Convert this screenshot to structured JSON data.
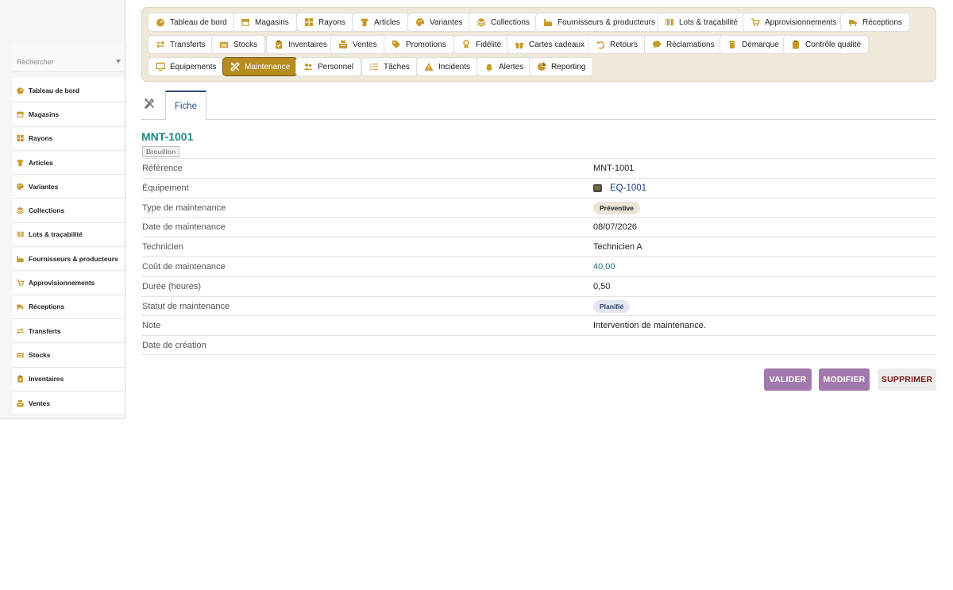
{
  "sidebar": {
    "search_placeholder": "Rechercher",
    "items": [
      {
        "label": "Tableau de bord",
        "icon": "dashboard-icon"
      },
      {
        "label": "Magasins",
        "icon": "store-icon"
      },
      {
        "label": "Rayons",
        "icon": "grid-icon"
      },
      {
        "label": "Articles",
        "icon": "shirt-icon"
      },
      {
        "label": "Variantes",
        "icon": "palette-icon"
      },
      {
        "label": "Collections",
        "icon": "layers-icon"
      },
      {
        "label": "Lots & traçabilité",
        "icon": "barcode-icon"
      },
      {
        "label": "Fournisseurs & producteurs",
        "icon": "factory-icon"
      },
      {
        "label": "Approvisionnements",
        "icon": "cart-icon"
      },
      {
        "label": "Réceptions",
        "icon": "truck-icon"
      },
      {
        "label": "Transferts",
        "icon": "transfer-icon"
      },
      {
        "label": "Stocks",
        "icon": "boxes-icon"
      },
      {
        "label": "Inventaires",
        "icon": "clipboard-icon"
      },
      {
        "label": "Ventes",
        "icon": "cash-register-icon"
      }
    ]
  },
  "topnav": {
    "items": [
      {
        "label": "Tableau de bord",
        "icon": "dashboard-icon"
      },
      {
        "label": "Magasins",
        "icon": "store-icon"
      },
      {
        "label": "Rayons",
        "icon": "grid-icon"
      },
      {
        "label": "Articles",
        "icon": "shirt-icon"
      },
      {
        "label": "Variantes",
        "icon": "palette-icon"
      },
      {
        "label": "Collections",
        "icon": "layers-icon"
      },
      {
        "label": "Fournisseurs & producteurs",
        "icon": "factory-icon"
      },
      {
        "label": "Lots & traçabilité",
        "icon": "barcode-icon"
      },
      {
        "label": "Approvisionnements",
        "icon": "cart-icon"
      },
      {
        "label": "Réceptions",
        "icon": "truck-icon"
      },
      {
        "label": "Transferts",
        "icon": "transfer-icon"
      },
      {
        "label": "Stocks",
        "icon": "boxes-icon"
      },
      {
        "label": "Inventaires",
        "icon": "clipboard-icon"
      },
      {
        "label": "Ventes",
        "icon": "cash-register-icon"
      },
      {
        "label": "Promotions",
        "icon": "tags-icon"
      },
      {
        "label": "Fidélité",
        "icon": "award-icon"
      },
      {
        "label": "Cartes cadeaux",
        "icon": "gift-icon"
      },
      {
        "label": "Retours",
        "icon": "undo-icon"
      },
      {
        "label": "Réclamations",
        "icon": "comment-icon"
      },
      {
        "label": "Démarque",
        "icon": "trash-icon"
      },
      {
        "label": "Contrôle qualité",
        "icon": "clipboard-check-icon"
      },
      {
        "label": "Équipements",
        "icon": "monitor-icon"
      },
      {
        "label": "Maintenance",
        "icon": "tools-icon"
      },
      {
        "label": "Personnel",
        "icon": "users-icon"
      },
      {
        "label": "Tâches",
        "icon": "tasks-icon"
      },
      {
        "label": "Incidents",
        "icon": "warning-icon"
      },
      {
        "label": "Alertes",
        "icon": "bell-icon"
      },
      {
        "label": "Reporting",
        "icon": "pie-chart-icon"
      }
    ],
    "active_label": "Maintenance"
  },
  "tabs": {
    "fiche": "Fiche",
    "tool_icon": "tools-icon"
  },
  "record": {
    "title": "MNT-1001",
    "status": "Brouillon",
    "fields": [
      {
        "label": "Référence",
        "value": "MNT-1001",
        "kind": "text"
      },
      {
        "label": "Équipement",
        "value": "EQ-1001",
        "kind": "link"
      },
      {
        "label": "Type de maintenance",
        "value": "Préventive",
        "kind": "badge-type"
      },
      {
        "label": "Date de maintenance",
        "value": "08/07/2026",
        "kind": "text"
      },
      {
        "label": "Technicien",
        "value": "Technicien A",
        "kind": "text"
      },
      {
        "label": "Coût de maintenance",
        "value": "40,00",
        "kind": "money"
      },
      {
        "label": "Durée (heures)",
        "value": "0,50",
        "kind": "text"
      },
      {
        "label": "Statut de maintenance",
        "value": "Planifié",
        "kind": "badge-stat"
      },
      {
        "label": "Note",
        "value": "Intervention de maintenance.",
        "kind": "text"
      },
      {
        "label": "Date de création",
        "value": "",
        "kind": "text"
      }
    ]
  },
  "actions": {
    "validate": "VALIDER",
    "modify": "MODIFIER",
    "delete": "SUPPRIMER"
  },
  "colors": {
    "accent_gold": "#b68c1e",
    "teal_title": "#1e8a84",
    "action_purple": "#a279ad",
    "delete_red": "#7a1616",
    "link_blue": "#1c3b84"
  }
}
